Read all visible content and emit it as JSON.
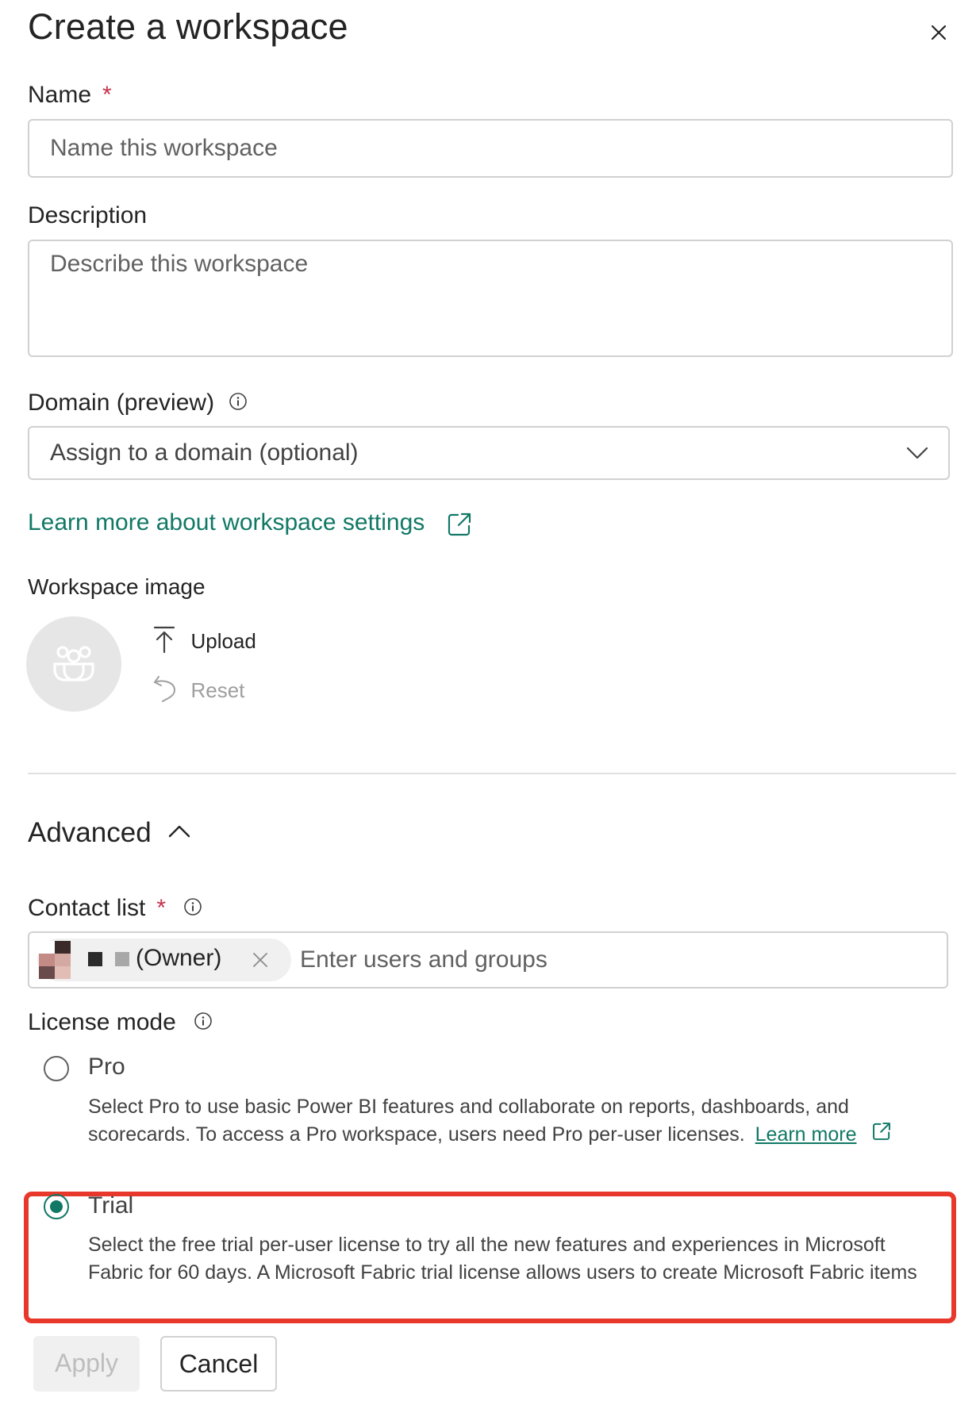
{
  "dialog": {
    "title": "Create a workspace",
    "close_icon": "close-icon"
  },
  "name_field": {
    "label": "Name",
    "required_mark": "*",
    "placeholder": "Name this workspace",
    "value": ""
  },
  "description_field": {
    "label": "Description",
    "placeholder": "Describe this workspace",
    "value": ""
  },
  "domain_field": {
    "label": "Domain (preview)",
    "info_icon": "info-icon",
    "placeholder": "Assign to a domain (optional)",
    "chevron_icon": "chevron-down-icon"
  },
  "learn_more_settings": {
    "text": "Learn more about workspace settings",
    "icon": "open-external-icon"
  },
  "workspace_image": {
    "label": "Workspace image",
    "upload_label": "Upload",
    "reset_label": "Reset"
  },
  "advanced": {
    "label": "Advanced",
    "icon": "chevron-up-icon"
  },
  "contact_list": {
    "label": "Contact list",
    "required_mark": "*",
    "owner_tag": "(Owner)",
    "placeholder": "Enter users and groups"
  },
  "license_mode": {
    "label": "License mode",
    "options": [
      {
        "label": "Pro",
        "selected": false,
        "description_line1": "Select Pro to use basic Power BI features and collaborate on reports, dashboards, and",
        "description_line2": "scorecards. To access a Pro workspace, users need Pro per-user licenses.",
        "learn_more": "Learn more"
      },
      {
        "label": "Trial",
        "selected": true,
        "description_line1": "Select the free trial per-user license to try all the new features and experiences in Microsoft",
        "description_line2": "Fabric for 60 days. A Microsoft Fabric trial license allows users to create Microsoft Fabric items"
      }
    ]
  },
  "footer": {
    "apply_label": "Apply",
    "cancel_label": "Cancel"
  },
  "colors": {
    "accent": "#117865",
    "highlight": "#e8382b",
    "required": "#c4314b"
  }
}
